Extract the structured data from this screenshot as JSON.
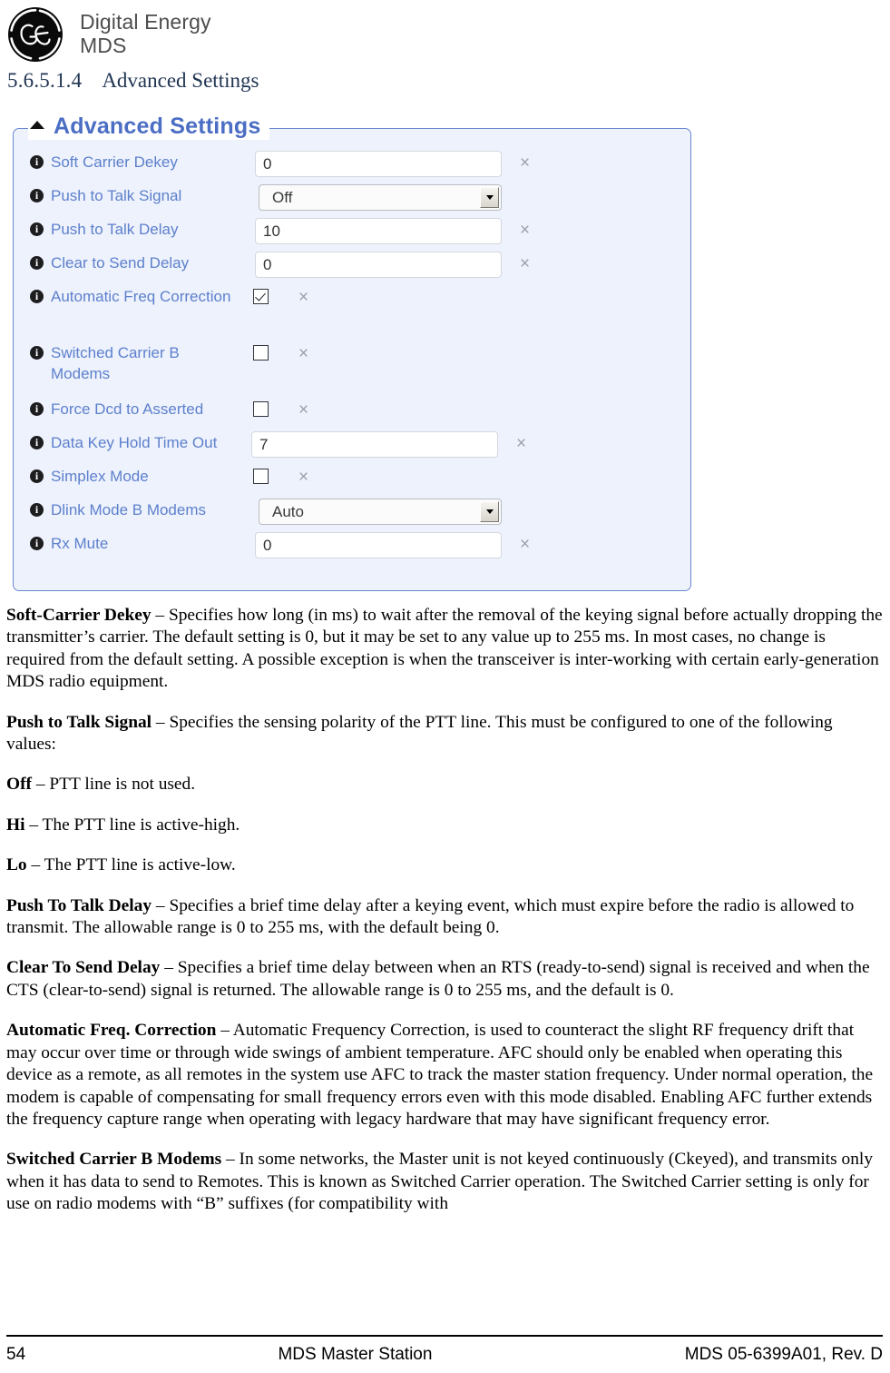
{
  "brand": {
    "logo_icon": "ge-monogram-logo",
    "wordmark_line1": "Digital Energy",
    "wordmark_line2": "MDS"
  },
  "heading": {
    "number": "5.6.5.1.4",
    "title": "Advanced Settings"
  },
  "panel": {
    "legend": "Advanced Settings",
    "collapse_icon": "chevron-up-icon",
    "accent_color": "#4b6ec4",
    "background_color": "#eef2fc",
    "border_color": "#6a87d0",
    "label_color": "#5d80cd",
    "rows": [
      {
        "label": "Soft Carrier Dekey",
        "type": "text",
        "value": "0",
        "clear": "×"
      },
      {
        "label": "Push to Talk Signal",
        "type": "select",
        "value": "Off",
        "clear": ""
      },
      {
        "label": "Push to Talk Delay",
        "type": "text",
        "value": "10",
        "clear": "×"
      },
      {
        "label": "Clear to Send Delay",
        "type": "text",
        "value": "0",
        "clear": "×"
      },
      {
        "label": "Automatic Freq Correction",
        "type": "checkbox",
        "checked": true,
        "clear": "×"
      },
      {
        "label": "Switched Carrier B Modems",
        "type": "checkbox",
        "checked": false,
        "clear": "×"
      },
      {
        "label": "Force Dcd to Asserted",
        "type": "checkbox",
        "checked": false,
        "clear": "×"
      },
      {
        "label": "Data Key Hold Time Out",
        "type": "text",
        "value": "7",
        "clear": "×"
      },
      {
        "label": "Simplex Mode",
        "type": "checkbox",
        "checked": false,
        "clear": "×"
      },
      {
        "label": "Dlink Mode B Modems",
        "type": "select",
        "value": "Auto",
        "clear": ""
      },
      {
        "label": "Rx Mute",
        "type": "text",
        "value": "0",
        "clear": "×"
      }
    ]
  },
  "body": {
    "paragraphs": [
      {
        "term": "Soft-Carrier Dekey",
        "text": " – Specifies how long (in ms) to wait after the removal of the keying signal before actually dropping the transmitter’s carrier. The default setting is 0, but it may be set to any value up to 255 ms. In most cases, no change is required from the default setting. A possible exception is when the transceiver is inter-working with certain early-generation MDS radio equipment."
      },
      {
        "term": "Push to Talk Signal",
        "text": " – Specifies the sensing polarity of the PTT line. This must be configured to one of the following values:"
      },
      {
        "term": "Off",
        "text": " – PTT line is not used."
      },
      {
        "term": "Hi",
        "text": " – The PTT line is active-high."
      },
      {
        "term": "Lo",
        "text": " – The PTT line is active-low."
      },
      {
        "term": "Push To Talk Delay",
        "text": " – Specifies a brief time delay after a keying event, which must expire before the radio is allowed to transmit. The allowable range is 0 to 255 ms, with the default being 0."
      },
      {
        "term": "Clear To Send Delay",
        "text": " – Specifies a brief time delay between when an RTS (ready-to-send) signal is received and when the CTS (clear-to-send) signal is returned. The allowable range is 0 to 255 ms, and the default is 0."
      },
      {
        "term": "Automatic Freq. Correction",
        "text": " – Automatic Frequency Correction, is used to counteract the slight RF frequency drift that may occur over time or through wide swings of ambient temperature. AFC should only be enabled when operating this device as a remote, as all remotes in the system use AFC to track the master station frequency. Under normal operation, the modem is capable of compensating for small frequency errors even with this mode disabled. Enabling AFC further extends the frequency capture range when operating with legacy hardware that may have significant frequency error."
      },
      {
        "term": "Switched Carrier B Modems",
        "text": " – In some networks, the Master unit is not keyed continuously (Ckeyed), and transmits only when it has data to send to Remotes. This is known as Switched Carrier operation. The Switched Carrier setting is only for use on radio modems with “B” suffixes (for compatibility with"
      }
    ]
  },
  "footer": {
    "page_number": "54",
    "center": "MDS Master Station",
    "right": "MDS 05-6399A01, Rev. D"
  }
}
